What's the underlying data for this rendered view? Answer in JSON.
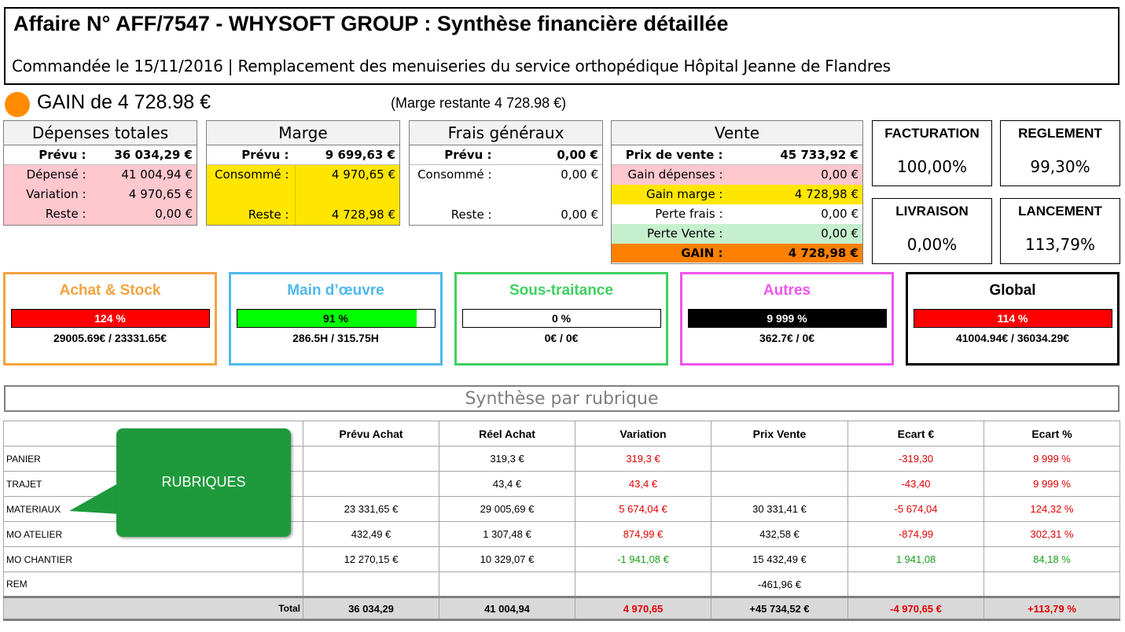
{
  "header": {
    "title": "Affaire N° AFF/7547 - WHYSOFT GROUP : Synthèse financière détaillée",
    "subtitle": "Commandée le 15/11/2016 | Remplacement des menuiseries du service orthopédique Hôpital Jeanne de Flandres"
  },
  "gain": {
    "text": "GAIN de 4 728.98 €",
    "marge_restante": "(Marge restante 4 728.98 €)",
    "dot_color": "#ff8c00"
  },
  "depenses": {
    "title": "Dépenses totales",
    "prevu_label": "Prévu :",
    "prevu": "36 034,29 €",
    "depense_label": "Dépensé :",
    "depense": "41 004,94 €",
    "variation_label": "Variation :",
    "variation": "4 970,65 €",
    "reste_label": "Reste :",
    "reste": "0,00 €"
  },
  "marge": {
    "title": "Marge",
    "prevu_label": "Prévu :",
    "prevu": "9 699,63 €",
    "consomme_label": "Consommé :",
    "consomme": "4 970,65 €",
    "reste_label": "Reste :",
    "reste": "4 728,98 €"
  },
  "frais": {
    "title": "Frais généraux",
    "prevu_label": "Prévu :",
    "prevu": "0,00 €",
    "consomme_label": "Consommé :",
    "consomme": "0,00 €",
    "reste_label": "Reste :",
    "reste": "0,00 €"
  },
  "vente": {
    "title": "Vente",
    "prix_label": "Prix de vente :",
    "prix": "45 733,92 €",
    "gain_dep_label": "Gain dépenses :",
    "gain_dep": "0,00 €",
    "gain_marge_label": "Gain marge :",
    "gain_marge": "4 728,98 €",
    "perte_frais_label": "Perte frais :",
    "perte_frais": "0,00 €",
    "perte_vente_label": "Perte Vente :",
    "perte_vente": "0,00 €",
    "gain_label": "GAIN :",
    "gain": "4 728,98 €"
  },
  "kpis": {
    "facturation": {
      "title": "FACTURATION",
      "value": "100,00%"
    },
    "reglement": {
      "title": "REGLEMENT",
      "value": "99,30%"
    },
    "livraison": {
      "title": "LIVRAISON",
      "value": "0,00%"
    },
    "lancement": {
      "title": "LANCEMENT",
      "value": "113,79%"
    }
  },
  "cards": [
    {
      "title": "Achat & Stock",
      "color": "#f4a340",
      "pct": "124 %",
      "fill": 1.0,
      "fill_color": "#ff0000",
      "pct_color": "#ffffff",
      "ratio": "29005.69€ / 23331.65€"
    },
    {
      "title": "Main d’œuvre",
      "color": "#4fb8ee",
      "pct": "91 %",
      "fill": 0.91,
      "fill_color": "#00ff00",
      "pct_color": "#000000",
      "ratio": "286.5H / 315.75H"
    },
    {
      "title": "Sous-traitance",
      "color": "#3fd060",
      "pct": "0 %",
      "fill": 0.0,
      "fill_color": "#ffffff",
      "pct_color": "#000000",
      "ratio": "0€ / 0€"
    },
    {
      "title": "Autres",
      "color": "#ee55ee",
      "pct": "9 999 %",
      "fill": 1.0,
      "fill_color": "#000000",
      "pct_color": "#ffffff",
      "ratio": "362.7€ / 0€"
    },
    {
      "title": "Global",
      "color": "#000000",
      "pct": "114 %",
      "fill": 1.0,
      "fill_color": "#ff0000",
      "pct_color": "#ffffff",
      "ratio": "41004.94€ / 36034.29€"
    }
  ],
  "synthese": {
    "title": "Synthèse par rubrique",
    "callout": "RUBRIQUES",
    "columns": [
      "Prévu Achat",
      "Réel Achat",
      "Variation",
      "Prix Vente",
      "Ecart  €",
      "Ecart %"
    ],
    "rows": [
      {
        "name": "PANIER",
        "prevu": "",
        "reel": "319,3 €",
        "variation": "319,3 €",
        "prix": "",
        "ecart": "-319,30",
        "ecart_pct": "9 999 %"
      },
      {
        "name": "TRAJET",
        "prevu": "",
        "reel": "43,4 €",
        "variation": "43,4 €",
        "prix": "",
        "ecart": "-43,40",
        "ecart_pct": "9 999 %"
      },
      {
        "name": "MATERIAUX",
        "prevu": "23 331,65 €",
        "reel": "29 005,69 €",
        "variation": "5 674,04 €",
        "prix": "30 331,41 €",
        "ecart": "-5 674,04",
        "ecart_pct": "124,32 %"
      },
      {
        "name": "MO ATELIER",
        "prevu": "432,49 €",
        "reel": "1 307,48 €",
        "variation": "874,99 €",
        "prix": "432,58 €",
        "ecart": "-874,99",
        "ecart_pct": "302,31 %"
      },
      {
        "name": "MO CHANTIER",
        "prevu": "12 270,15 €",
        "reel": "10 329,07 €",
        "variation": "-1 941,08 €",
        "prix": "15 432,49 €",
        "ecart": "1 941,08",
        "ecart_pct": "84,18 %"
      },
      {
        "name": "REM",
        "prevu": "",
        "reel": "",
        "variation": "",
        "prix": "-461,96 €",
        "ecart": "",
        "ecart_pct": ""
      }
    ],
    "total": {
      "label": "Total",
      "prevu": "36 034,29",
      "reel": "41 004,94",
      "variation": "4 970,65",
      "prix": "+45 734,52 €",
      "ecart": "-4 970,65 €",
      "ecart_pct": "+113,79 %"
    }
  }
}
